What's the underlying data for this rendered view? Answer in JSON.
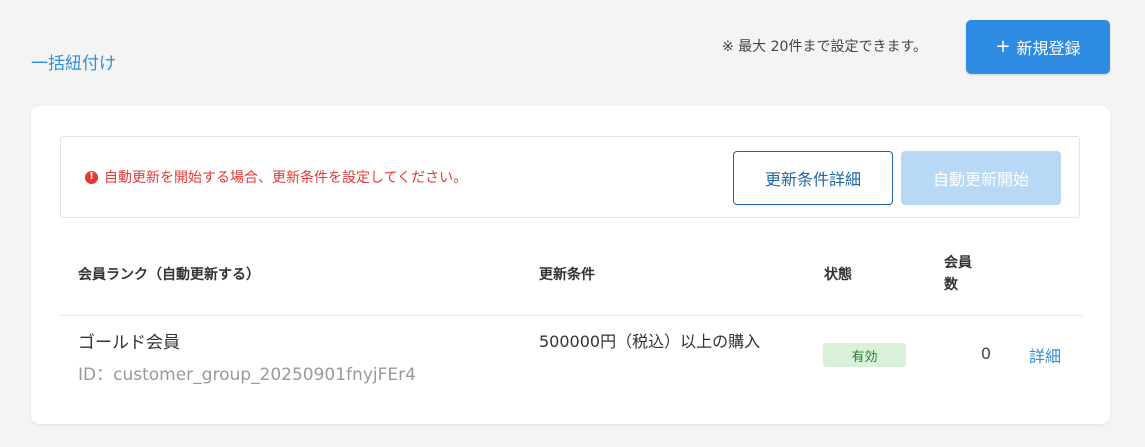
{
  "header": {
    "bulk_link": "一括紐付け",
    "limit_note": "※ 最大 20件まで設定できます。",
    "new_button_icon": "+",
    "new_button_label": "新規登録"
  },
  "alert": {
    "icon": "!",
    "message": "自動更新を開始する場合、更新条件を設定してください。",
    "details_button": "更新条件詳細",
    "start_button": "自動更新開始"
  },
  "table": {
    "headers": {
      "rank": "会員ランク（自動更新する）",
      "condition": "更新条件",
      "status": "状態",
      "count": "会員数"
    },
    "rows": [
      {
        "name": "ゴールド会員",
        "id": "ID：customer_group_20250901fnyjFEr4",
        "condition": "500000円（税込）以上の購入",
        "status": "有効",
        "count": "0",
        "detail": "詳細"
      }
    ]
  },
  "colors": {
    "primary": "#2e8de3",
    "link": "#2f8fd6",
    "alert": "#e53935",
    "status_active_bg": "#d9f0d9",
    "status_active_text": "#2e7d32"
  }
}
